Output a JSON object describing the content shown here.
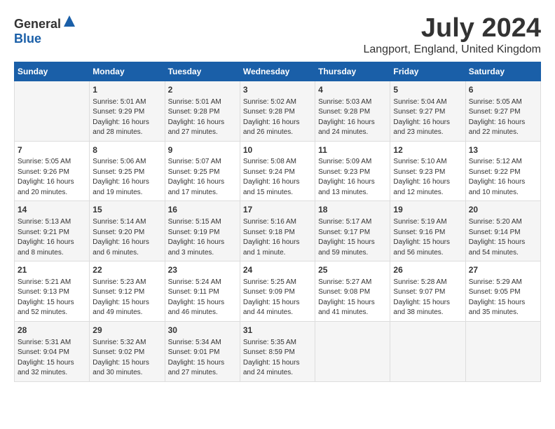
{
  "header": {
    "logo_general": "General",
    "logo_blue": "Blue",
    "title": "July 2024",
    "subtitle": "Langport, England, United Kingdom"
  },
  "days_of_week": [
    "Sunday",
    "Monday",
    "Tuesday",
    "Wednesday",
    "Thursday",
    "Friday",
    "Saturday"
  ],
  "weeks": [
    {
      "cells": [
        {
          "day": "",
          "content": ""
        },
        {
          "day": "1",
          "content": "Sunrise: 5:01 AM\nSunset: 9:29 PM\nDaylight: 16 hours\nand 28 minutes."
        },
        {
          "day": "2",
          "content": "Sunrise: 5:01 AM\nSunset: 9:28 PM\nDaylight: 16 hours\nand 27 minutes."
        },
        {
          "day": "3",
          "content": "Sunrise: 5:02 AM\nSunset: 9:28 PM\nDaylight: 16 hours\nand 26 minutes."
        },
        {
          "day": "4",
          "content": "Sunrise: 5:03 AM\nSunset: 9:28 PM\nDaylight: 16 hours\nand 24 minutes."
        },
        {
          "day": "5",
          "content": "Sunrise: 5:04 AM\nSunset: 9:27 PM\nDaylight: 16 hours\nand 23 minutes."
        },
        {
          "day": "6",
          "content": "Sunrise: 5:05 AM\nSunset: 9:27 PM\nDaylight: 16 hours\nand 22 minutes."
        }
      ]
    },
    {
      "cells": [
        {
          "day": "7",
          "content": "Sunrise: 5:05 AM\nSunset: 9:26 PM\nDaylight: 16 hours\nand 20 minutes."
        },
        {
          "day": "8",
          "content": "Sunrise: 5:06 AM\nSunset: 9:25 PM\nDaylight: 16 hours\nand 19 minutes."
        },
        {
          "day": "9",
          "content": "Sunrise: 5:07 AM\nSunset: 9:25 PM\nDaylight: 16 hours\nand 17 minutes."
        },
        {
          "day": "10",
          "content": "Sunrise: 5:08 AM\nSunset: 9:24 PM\nDaylight: 16 hours\nand 15 minutes."
        },
        {
          "day": "11",
          "content": "Sunrise: 5:09 AM\nSunset: 9:23 PM\nDaylight: 16 hours\nand 13 minutes."
        },
        {
          "day": "12",
          "content": "Sunrise: 5:10 AM\nSunset: 9:23 PM\nDaylight: 16 hours\nand 12 minutes."
        },
        {
          "day": "13",
          "content": "Sunrise: 5:12 AM\nSunset: 9:22 PM\nDaylight: 16 hours\nand 10 minutes."
        }
      ]
    },
    {
      "cells": [
        {
          "day": "14",
          "content": "Sunrise: 5:13 AM\nSunset: 9:21 PM\nDaylight: 16 hours\nand 8 minutes."
        },
        {
          "day": "15",
          "content": "Sunrise: 5:14 AM\nSunset: 9:20 PM\nDaylight: 16 hours\nand 6 minutes."
        },
        {
          "day": "16",
          "content": "Sunrise: 5:15 AM\nSunset: 9:19 PM\nDaylight: 16 hours\nand 3 minutes."
        },
        {
          "day": "17",
          "content": "Sunrise: 5:16 AM\nSunset: 9:18 PM\nDaylight: 16 hours\nand 1 minute."
        },
        {
          "day": "18",
          "content": "Sunrise: 5:17 AM\nSunset: 9:17 PM\nDaylight: 15 hours\nand 59 minutes."
        },
        {
          "day": "19",
          "content": "Sunrise: 5:19 AM\nSunset: 9:16 PM\nDaylight: 15 hours\nand 56 minutes."
        },
        {
          "day": "20",
          "content": "Sunrise: 5:20 AM\nSunset: 9:14 PM\nDaylight: 15 hours\nand 54 minutes."
        }
      ]
    },
    {
      "cells": [
        {
          "day": "21",
          "content": "Sunrise: 5:21 AM\nSunset: 9:13 PM\nDaylight: 15 hours\nand 52 minutes."
        },
        {
          "day": "22",
          "content": "Sunrise: 5:23 AM\nSunset: 9:12 PM\nDaylight: 15 hours\nand 49 minutes."
        },
        {
          "day": "23",
          "content": "Sunrise: 5:24 AM\nSunset: 9:11 PM\nDaylight: 15 hours\nand 46 minutes."
        },
        {
          "day": "24",
          "content": "Sunrise: 5:25 AM\nSunset: 9:09 PM\nDaylight: 15 hours\nand 44 minutes."
        },
        {
          "day": "25",
          "content": "Sunrise: 5:27 AM\nSunset: 9:08 PM\nDaylight: 15 hours\nand 41 minutes."
        },
        {
          "day": "26",
          "content": "Sunrise: 5:28 AM\nSunset: 9:07 PM\nDaylight: 15 hours\nand 38 minutes."
        },
        {
          "day": "27",
          "content": "Sunrise: 5:29 AM\nSunset: 9:05 PM\nDaylight: 15 hours\nand 35 minutes."
        }
      ]
    },
    {
      "cells": [
        {
          "day": "28",
          "content": "Sunrise: 5:31 AM\nSunset: 9:04 PM\nDaylight: 15 hours\nand 32 minutes."
        },
        {
          "day": "29",
          "content": "Sunrise: 5:32 AM\nSunset: 9:02 PM\nDaylight: 15 hours\nand 30 minutes."
        },
        {
          "day": "30",
          "content": "Sunrise: 5:34 AM\nSunset: 9:01 PM\nDaylight: 15 hours\nand 27 minutes."
        },
        {
          "day": "31",
          "content": "Sunrise: 5:35 AM\nSunset: 8:59 PM\nDaylight: 15 hours\nand 24 minutes."
        },
        {
          "day": "",
          "content": ""
        },
        {
          "day": "",
          "content": ""
        },
        {
          "day": "",
          "content": ""
        }
      ]
    }
  ]
}
